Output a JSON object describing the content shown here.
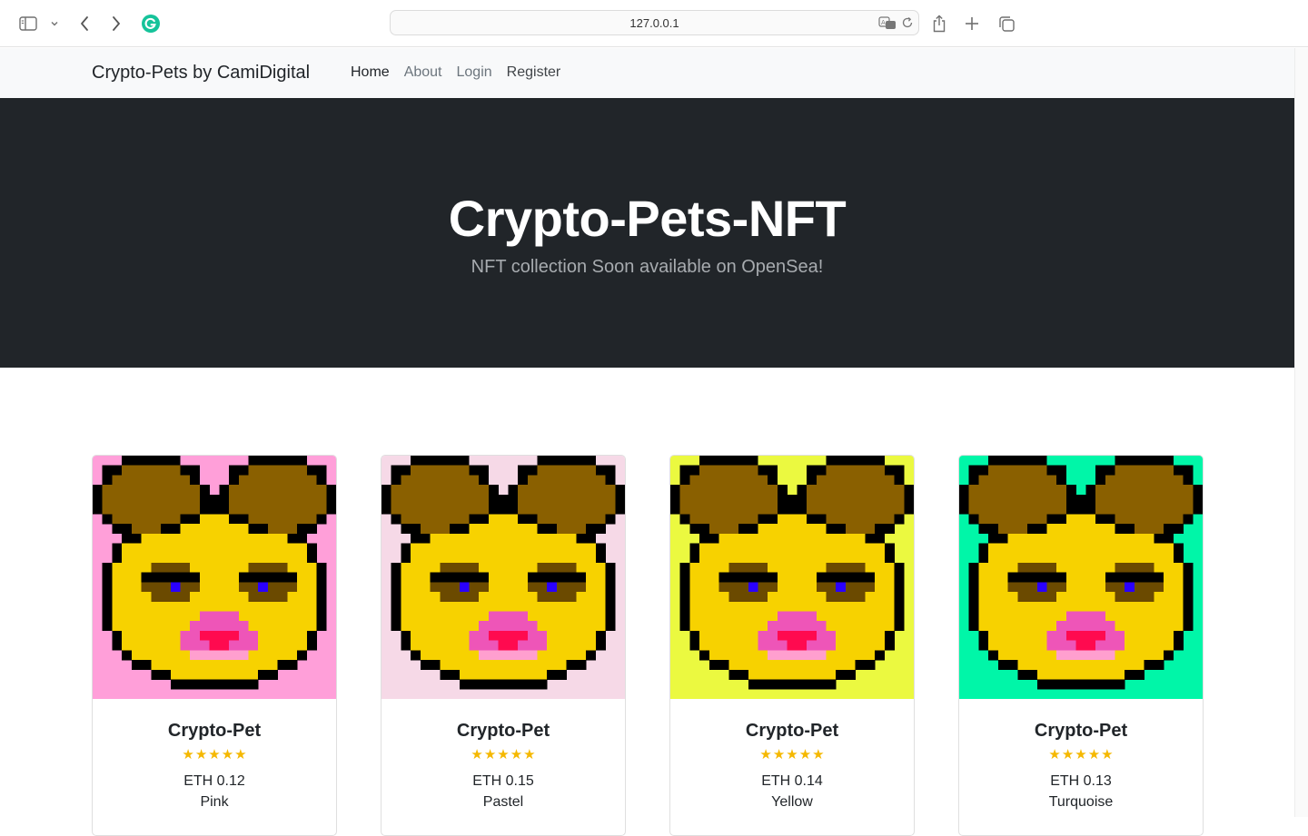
{
  "browser": {
    "url": "127.0.0.1",
    "icons": [
      "sidebar-icon",
      "chevron-down-icon",
      "back-icon",
      "forward-icon",
      "grammarly-icon",
      "translate-icon",
      "reload-icon",
      "share-icon",
      "new-tab-icon",
      "tabs-overview-icon"
    ]
  },
  "navbar": {
    "brand": "Crypto-Pets by CamiDigital",
    "links": [
      {
        "label": "Home"
      },
      {
        "label": "About"
      },
      {
        "label": "Login"
      },
      {
        "label": "Register"
      }
    ]
  },
  "hero": {
    "title": "Crypto-Pets-NFT",
    "subtitle": "NFT collection Soon available on OpenSea!"
  },
  "cards": [
    {
      "title": "Crypto-Pet",
      "rating": 5,
      "price": "ETH 0.12",
      "color": "Pink",
      "bg": "#ff9fd9"
    },
    {
      "title": "Crypto-Pet",
      "rating": 5,
      "price": "ETH 0.15",
      "color": "Pastel",
      "bg": "#f6d9e7"
    },
    {
      "title": "Crypto-Pet",
      "rating": 5,
      "price": "ETH 0.14",
      "color": "Yellow",
      "bg": "#ebf940"
    },
    {
      "title": "Crypto-Pet",
      "rating": 5,
      "price": "ETH 0.13",
      "color": "Turquoise",
      "bg": "#00f6a8"
    }
  ],
  "colors": {
    "hero_bg": "#212529",
    "star": "#f5b800",
    "pet_face": "#f7d200",
    "pet_ears": "#8a6000",
    "pet_outline": "#000000",
    "pet_eye": "#2a00ff",
    "pet_nose": "#ff0a4f",
    "pet_snout": "#ee55b8"
  }
}
